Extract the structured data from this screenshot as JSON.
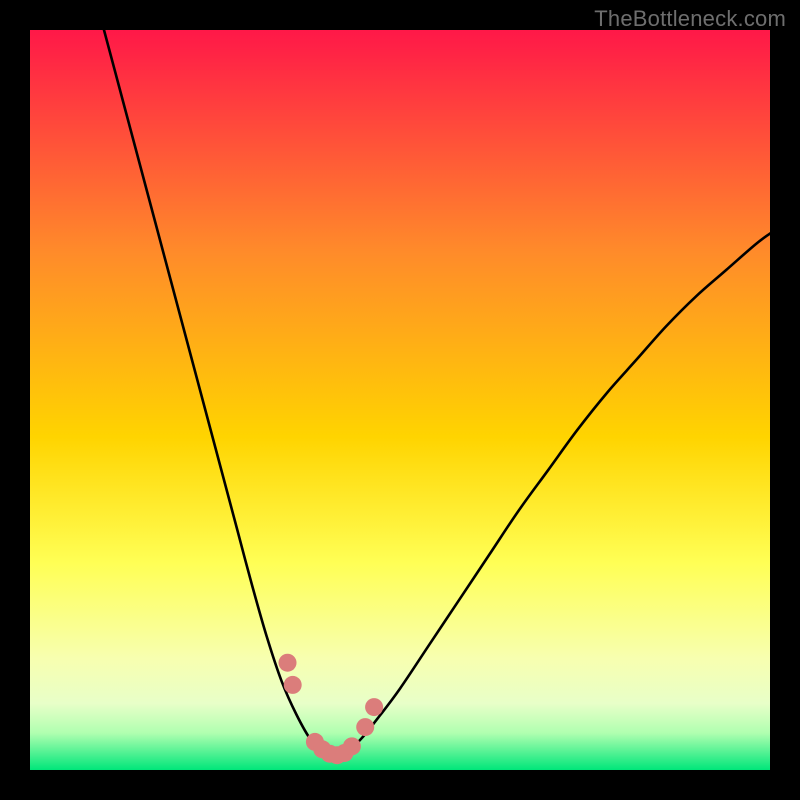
{
  "watermark": "TheBottleneck.com",
  "colors": {
    "curve": "#000000",
    "markers_fill": "#db7d7b",
    "markers_stroke": "#b45a58",
    "background_black": "#000000",
    "gradient_top": "#ff1848",
    "gradient_mid_upper": "#ff8b2a",
    "gradient_mid": "#ffd400",
    "gradient_mid_lower": "#ffff55",
    "gradient_band": "#f7ffb0",
    "gradient_bottom": "#00e67a"
  },
  "chart_data": {
    "type": "line",
    "title": "",
    "xlabel": "",
    "ylabel": "",
    "xlim": [
      0,
      100
    ],
    "ylim": [
      0,
      100
    ],
    "gradient_stops": [
      {
        "pct": 0,
        "color": "#ff1848"
      },
      {
        "pct": 30,
        "color": "#ff8b2a"
      },
      {
        "pct": 55,
        "color": "#ffd400"
      },
      {
        "pct": 72,
        "color": "#ffff55"
      },
      {
        "pct": 85,
        "color": "#f7ffb0"
      },
      {
        "pct": 91,
        "color": "#e8ffc8"
      },
      {
        "pct": 95,
        "color": "#b0ffb0"
      },
      {
        "pct": 100,
        "color": "#00e67a"
      }
    ],
    "series": [
      {
        "name": "left-curve",
        "x": [
          10,
          12,
          14,
          16,
          18,
          20,
          22,
          24,
          26,
          28,
          30,
          32,
          34,
          36,
          38,
          40,
          41
        ],
        "y": [
          100,
          92.5,
          85,
          77.5,
          70,
          62.5,
          55,
          47.5,
          40,
          32.5,
          25,
          18,
          12,
          7.5,
          4,
          2,
          1.5
        ]
      },
      {
        "name": "right-curve",
        "x": [
          41,
          43,
          45,
          47,
          50,
          54,
          58,
          62,
          66,
          70,
          74,
          78,
          82,
          86,
          90,
          94,
          98,
          100
        ],
        "y": [
          1.5,
          2.5,
          4.5,
          7,
          11,
          17,
          23,
          29,
          35,
          40.5,
          46,
          51,
          55.5,
          60,
          64,
          67.5,
          71,
          72.5
        ]
      }
    ],
    "markers": [
      {
        "x": 34.8,
        "y": 14.5
      },
      {
        "x": 35.5,
        "y": 11.5
      },
      {
        "x": 38.5,
        "y": 3.8
      },
      {
        "x": 39.5,
        "y": 2.8
      },
      {
        "x": 40.5,
        "y": 2.2
      },
      {
        "x": 41.5,
        "y": 2.0
      },
      {
        "x": 42.5,
        "y": 2.3
      },
      {
        "x": 43.5,
        "y": 3.2
      },
      {
        "x": 45.3,
        "y": 5.8
      },
      {
        "x": 46.5,
        "y": 8.5
      }
    ],
    "marker_radius": 9
  }
}
